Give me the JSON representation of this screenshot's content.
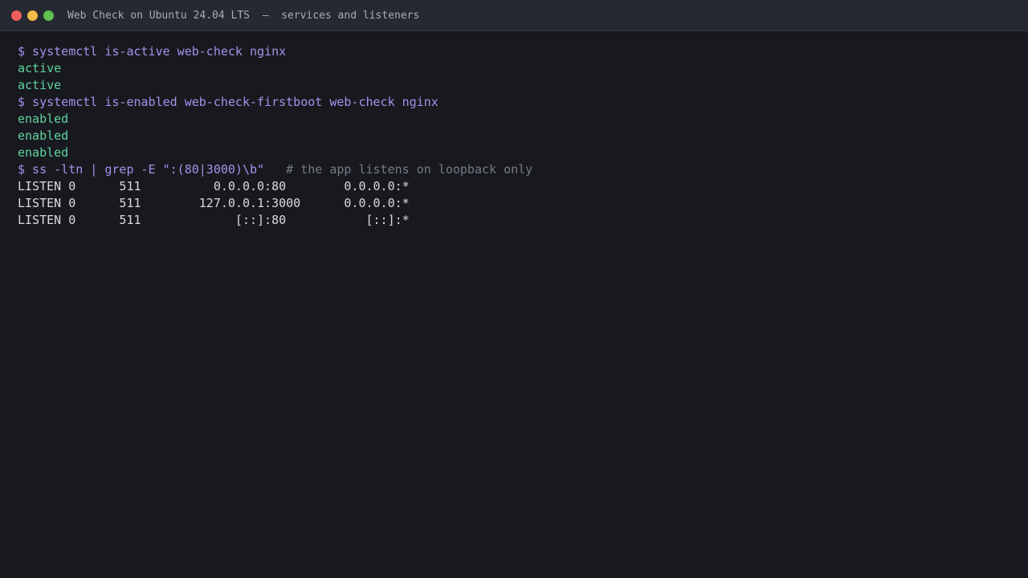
{
  "window": {
    "title": "Web Check on Ubuntu 24.04 LTS  –  services and listeners",
    "colors": {
      "close": "#ee5e5a",
      "minimize": "#f2bb4a",
      "maximize": "#5fc150",
      "command": "#a890ec",
      "success": "#5fd3a0",
      "comment": "#767a85",
      "output": "#d8dae0",
      "background": "#18191e"
    }
  },
  "terminal": {
    "cmd1": "$ systemctl is-active web-check nginx",
    "cmd1_out": [
      "active",
      "active"
    ],
    "cmd2": "$ systemctl is-enabled web-check-firstboot web-check nginx",
    "cmd2_out": [
      "enabled",
      "enabled",
      "enabled"
    ],
    "cmd3": "$ ss -ltn | grep -E \":(80|3000)\\b\"",
    "cmd3_comment": "# the app listens on loopback only",
    "ss_rows": [
      "LISTEN 0      511          0.0.0.0:80        0.0.0.0:*",
      "LISTEN 0      511        127.0.0.1:3000      0.0.0.0:*",
      "LISTEN 0      511             [::]:80           [::]:*"
    ]
  }
}
